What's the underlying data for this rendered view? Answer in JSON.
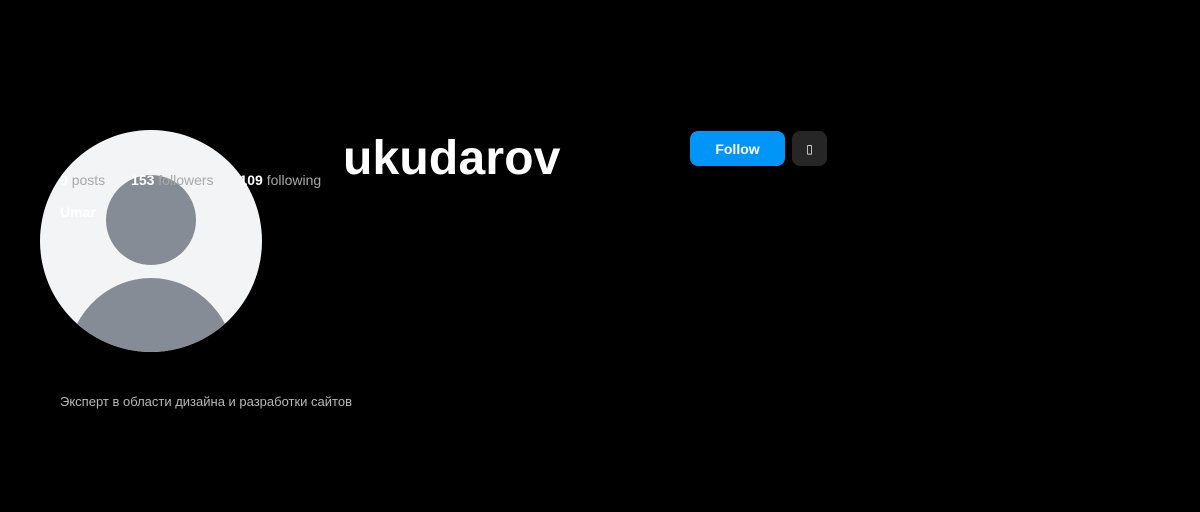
{
  "profile": {
    "username": "ukudarov",
    "display_name": "Umar",
    "bio": "Эксперт в области дизайна и разработки сайтов",
    "avatar_icon": "default-user-icon"
  },
  "stats": {
    "posts_count": "0",
    "posts_label": "posts",
    "followers_count": "153",
    "followers_label": "followers",
    "following_count": "109",
    "following_label": "following"
  },
  "actions": {
    "follow_label": "Follow",
    "more_label": "▯",
    "more_icon": "more-options-icon"
  },
  "colors": {
    "background": "#000000",
    "accent": "#0095f6",
    "secondary_button": "#262626",
    "avatar_bg": "#f3f4f6",
    "avatar_silhouette": "#868c96"
  }
}
